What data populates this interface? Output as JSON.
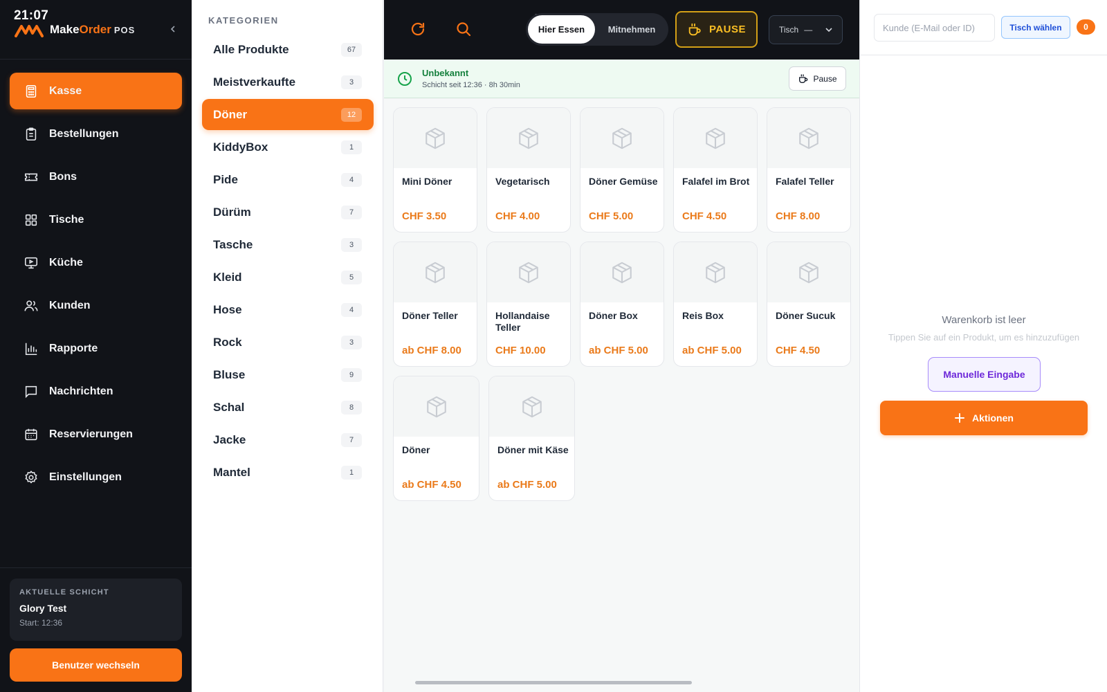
{
  "app": {
    "clock": "21:07",
    "brand_make": "Make",
    "brand_order": "Order",
    "brand_pos": "POS"
  },
  "sidebar": {
    "items": [
      {
        "label": "Kasse",
        "icon": "calculator-icon",
        "active": true
      },
      {
        "label": "Bestellungen",
        "icon": "clipboard-icon"
      },
      {
        "label": "Bons",
        "icon": "ticket-icon"
      },
      {
        "label": "Tische",
        "icon": "grid-icon"
      },
      {
        "label": "Küche",
        "icon": "monitor-icon"
      },
      {
        "label": "Kunden",
        "icon": "users-icon"
      },
      {
        "label": "Rapporte",
        "icon": "bar-chart-icon"
      },
      {
        "label": "Nachrichten",
        "icon": "message-icon"
      },
      {
        "label": "Reservierungen",
        "icon": "calendar-icon"
      },
      {
        "label": "Einstellungen",
        "icon": "gear-icon"
      }
    ],
    "shift": {
      "label": "AKTUELLE SCHICHT",
      "name": "Glory Test",
      "start": "Start: 12:36"
    },
    "switch_user": "Benutzer wechseln"
  },
  "categories": {
    "heading": "KATEGORIEN",
    "items": [
      {
        "label": "Alle Produkte",
        "count": "67"
      },
      {
        "label": "Meistverkaufte",
        "count": "3"
      },
      {
        "label": "Döner",
        "count": "12",
        "active": true
      },
      {
        "label": "KiddyBox",
        "count": "1"
      },
      {
        "label": "Pide",
        "count": "4"
      },
      {
        "label": "Dürüm",
        "count": "7"
      },
      {
        "label": "Tasche",
        "count": "3"
      },
      {
        "label": "Kleid",
        "count": "5"
      },
      {
        "label": "Hose",
        "count": "4"
      },
      {
        "label": "Rock",
        "count": "3"
      },
      {
        "label": "Bluse",
        "count": "9"
      },
      {
        "label": "Schal",
        "count": "8"
      },
      {
        "label": "Jacke",
        "count": "7"
      },
      {
        "label": "Mantel",
        "count": "1"
      }
    ]
  },
  "topbar": {
    "mode_dine_in": "Hier Essen",
    "mode_takeaway": "Mitnehmen",
    "pause": "PAUSE",
    "table_label": "Tisch",
    "table_value": "—"
  },
  "banner": {
    "title": "Unbekannt",
    "subtitle": "Schicht seit 12:36 · 8h 30min",
    "pause": "Pause"
  },
  "products": [
    {
      "name": "Mini Döner",
      "price": "CHF 3.50"
    },
    {
      "name": "Vegetarisch",
      "price": "CHF 4.00"
    },
    {
      "name": "Döner Gemüse",
      "price": "CHF 5.00"
    },
    {
      "name": "Falafel im Brot",
      "price": "CHF 4.50"
    },
    {
      "name": "Falafel Teller",
      "price": "CHF 8.00"
    },
    {
      "name": "Döner Teller",
      "price": "ab CHF 8.00"
    },
    {
      "name": "Hollandaise Teller",
      "price": "CHF 10.00"
    },
    {
      "name": "Döner Box",
      "price": "ab CHF 5.00"
    },
    {
      "name": "Reis Box",
      "price": "ab CHF 5.00"
    },
    {
      "name": "Döner Sucuk",
      "price": "CHF 4.50"
    },
    {
      "name": "Döner",
      "price": "ab CHF 4.50"
    },
    {
      "name": "Döner mit Käse",
      "price": "ab CHF 5.00"
    }
  ],
  "cart": {
    "customer_placeholder": "Kunde (E-Mail oder ID)",
    "choose_table": "Tisch wählen",
    "item_count": "0",
    "empty_title": "Warenkorb ist leer",
    "empty_hint": "Tippen Sie auf ein Produkt, um es hinzuzufügen",
    "manual_entry": "Manuelle Eingabe",
    "actions": "Aktionen"
  },
  "colors": {
    "accent": "#f97316",
    "sidebar_bg": "#111318",
    "price": "#ea7a1a",
    "shift_ok": "#15803d"
  }
}
